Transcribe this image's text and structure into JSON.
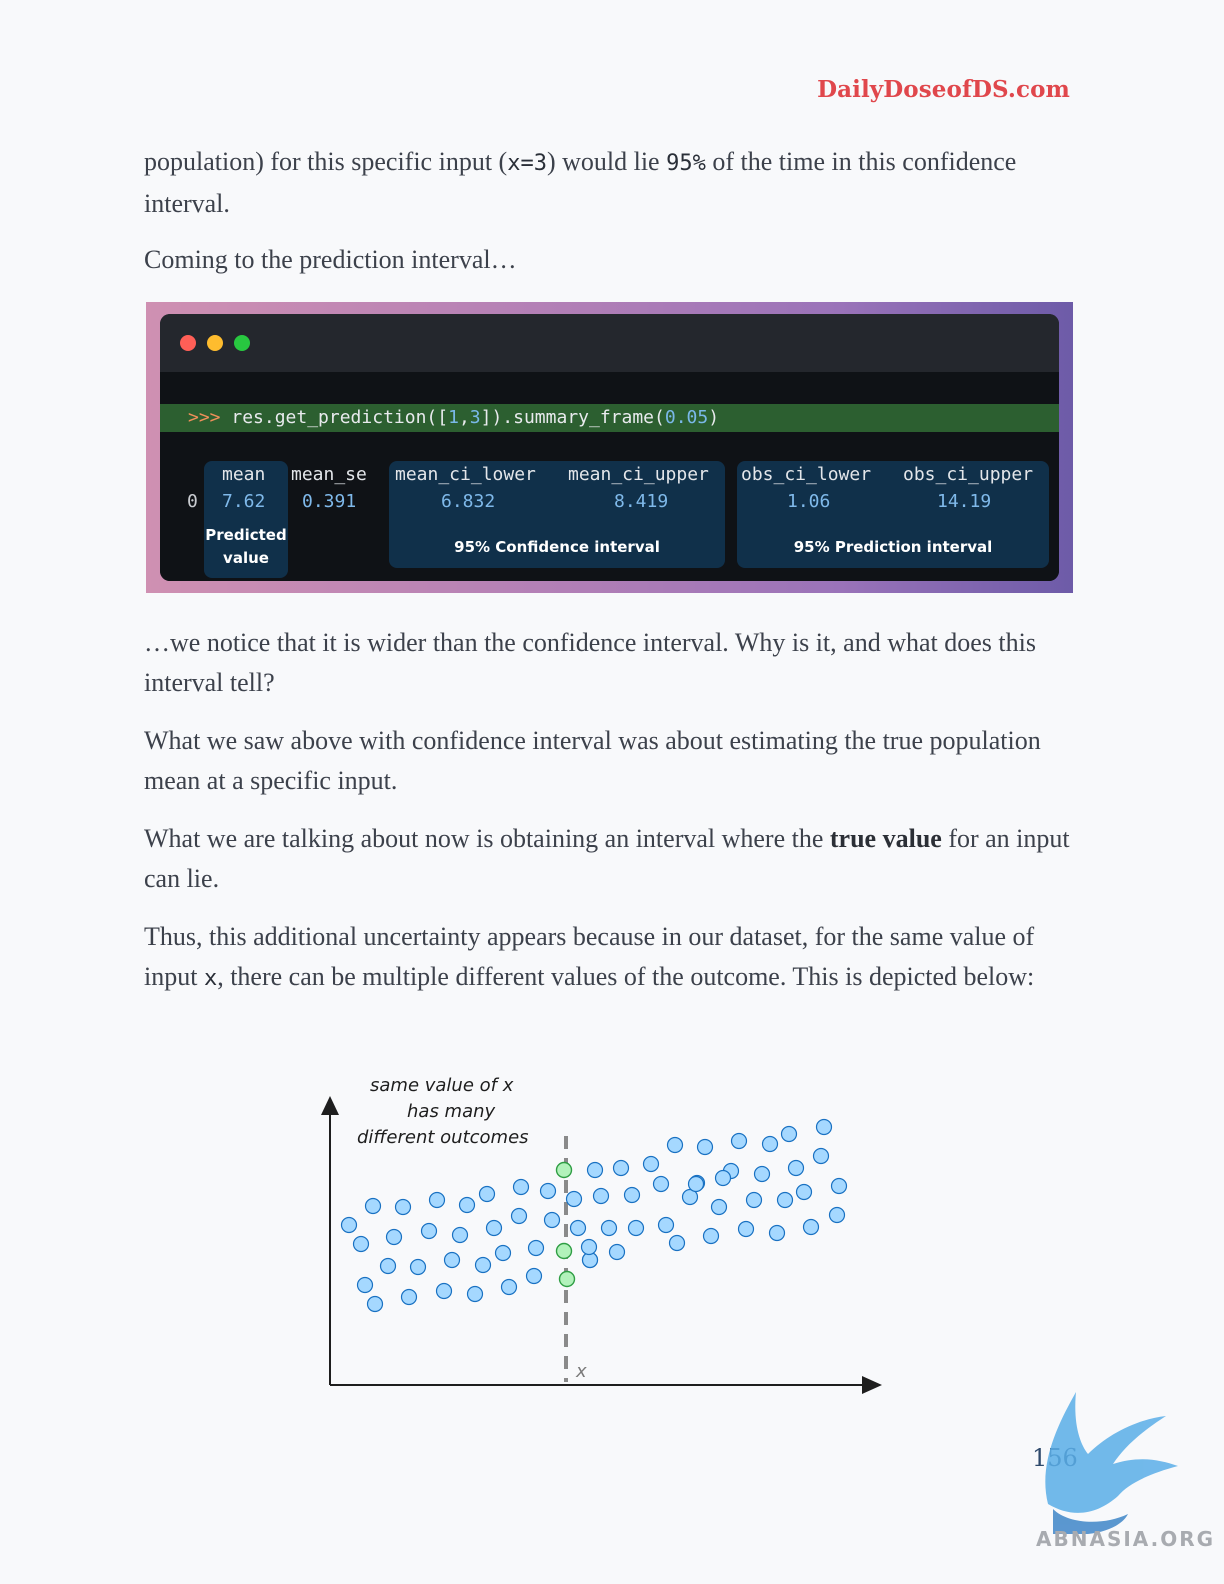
{
  "header": {
    "brand": "DailyDoseofDS.com"
  },
  "paragraphs": {
    "p1_a": "population) for this specific input (",
    "p1_code1": "x=3",
    "p1_b": ") would lie ",
    "p1_code2": "95%",
    "p1_c": " of the time in this confidence interval.",
    "p2": "Coming to the prediction interval…",
    "p3": "…we notice that it is wider than the confidence interval. Why is it, and what does this interval tell?",
    "p4": "What we saw above with confidence interval was about estimating the true population mean at a specific input.",
    "p5_a": "What we are talking about now is obtaining an interval where the ",
    "p5_bold": "true value",
    "p5_b": " for an input can lie.",
    "p6_a": "Thus, this additional uncertainty appears because in our dataset, for the same value of input ",
    "p6_code": "x",
    "p6_b": ", there can be multiple different values of the outcome. This is depicted below:"
  },
  "code_snippet": {
    "prompt": ">>>",
    "call_text": " res.get_prediction([",
    "arg1": "1",
    "comma": ",",
    "arg2": "3",
    "call_mid": "]).summary_frame(",
    "alpha": "0.05",
    "call_end": ")",
    "columns": [
      "mean",
      "mean_se",
      "mean_ci_lower",
      "mean_ci_upper",
      "obs_ci_lower",
      "obs_ci_upper"
    ],
    "row_index": "0",
    "row_values": [
      "7.62",
      "0.391",
      "6.832",
      "8.419",
      "1.06",
      "14.19"
    ],
    "labels": {
      "predicted_line1": "Predicted",
      "predicted_line2": "value",
      "confidence": "95% Confidence interval",
      "prediction": "95% Prediction interval"
    }
  },
  "diagram": {
    "annotation_line1": "same value of x",
    "annotation_line2": "has many",
    "annotation_line3": "different outcomes",
    "x_axis_label": "x",
    "colors": {
      "point_fill": "#a5d8ff",
      "point_stroke": "#1971c2",
      "highlight_fill": "#b2f2bb",
      "highlight_stroke": "#2f9e44"
    }
  },
  "footer": {
    "page_number": "156",
    "watermark": "ABNASIA.ORG"
  }
}
